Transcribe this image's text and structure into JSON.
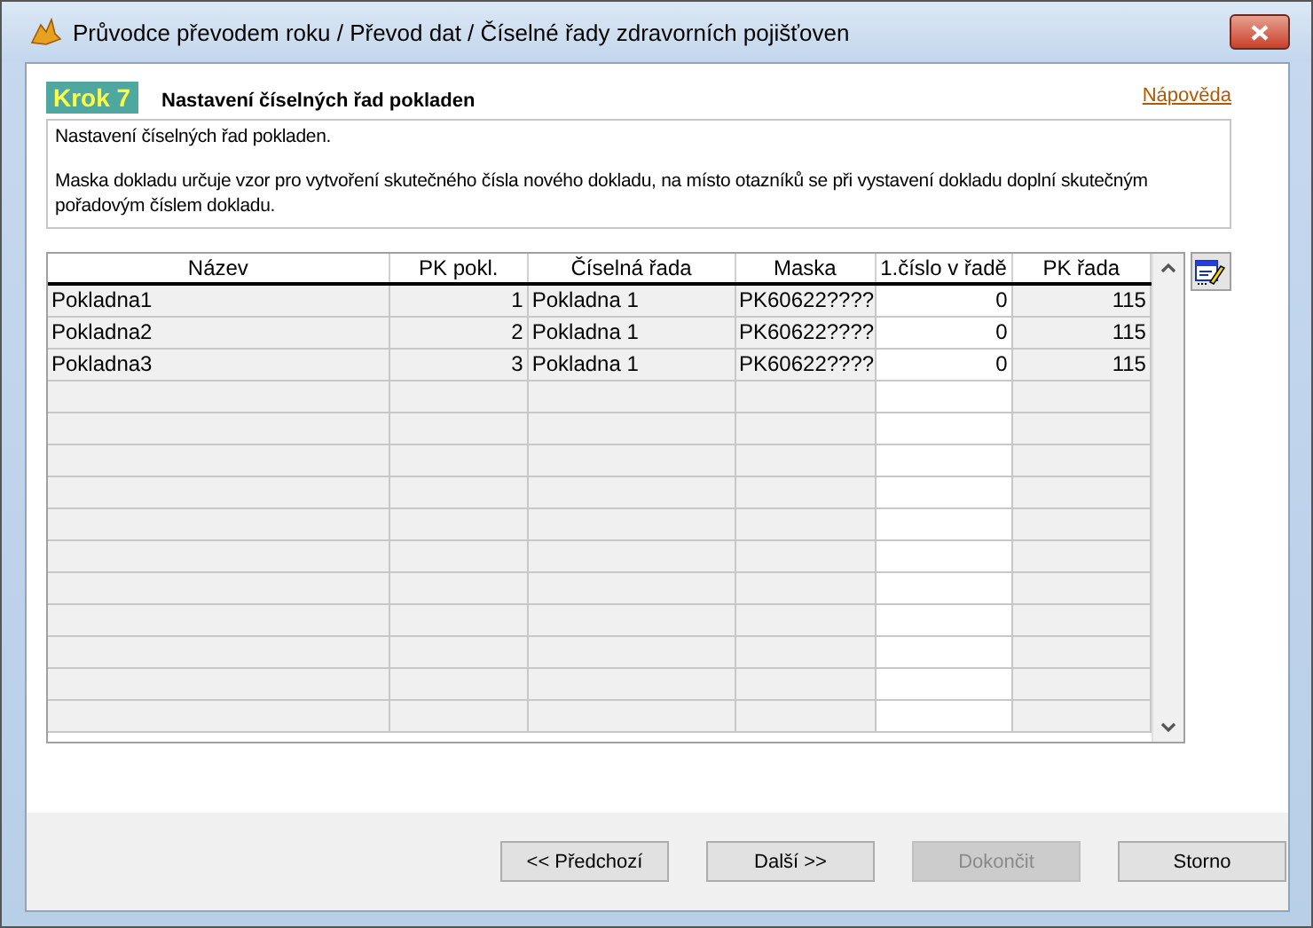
{
  "window": {
    "title": "Průvodce převodem roku / Převod dat / Číselné řady zdravorních pojišťoven"
  },
  "step": {
    "badge": "Krok 7",
    "title": "Nastavení číselných řad pokladen",
    "help_link": "Nápověda"
  },
  "description": [
    "Nastavení číselných řad pokladen.",
    "Maska dokladu určuje vzor pro vytvoření skutečného čísla nového dokladu, na místo otazníků se při vystavení dokladu doplní skutečným pořadovým číslem dokladu."
  ],
  "table": {
    "columns": [
      {
        "label": "Název",
        "numeric": false,
        "editable": false
      },
      {
        "label": "PK pokl.",
        "numeric": true,
        "editable": false
      },
      {
        "label": "Číselná řada",
        "numeric": false,
        "editable": false
      },
      {
        "label": "Maska",
        "numeric": false,
        "editable": false
      },
      {
        "label": "1.číslo v řadě",
        "numeric": true,
        "editable": true
      },
      {
        "label": "PK řada",
        "numeric": true,
        "editable": false
      }
    ],
    "rows": [
      [
        "Pokladna1",
        "1",
        "Pokladna 1",
        "PK60622????",
        "0",
        "115"
      ],
      [
        "Pokladna2",
        "2",
        "Pokladna 1",
        "PK60622????",
        "0",
        "115"
      ],
      [
        "Pokladna3",
        "3",
        "Pokladna 1",
        "PK60622????",
        "0",
        "115"
      ]
    ]
  },
  "buttons": [
    {
      "label": "<< Předchozí",
      "disabled": false
    },
    {
      "label": "Další >>",
      "disabled": false
    },
    {
      "label": "Dokončit",
      "disabled": true
    },
    {
      "label": "Storno",
      "disabled": false
    }
  ]
}
